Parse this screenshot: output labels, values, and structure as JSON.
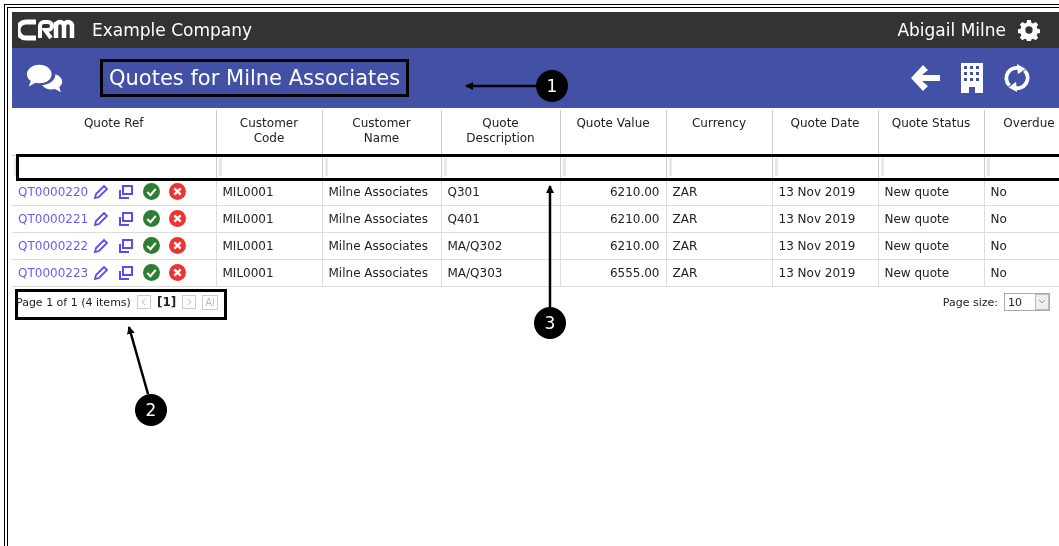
{
  "topbar": {
    "company": "Example Company",
    "user": "Abigail Milne"
  },
  "header": {
    "title": "Quotes for Milne Associates"
  },
  "table": {
    "columns": [
      "Quote Ref",
      "Customer Code",
      "Customer Name",
      "Quote Description",
      "Quote Value",
      "Currency",
      "Quote Date",
      "Quote Status",
      "Overdue"
    ],
    "rows": [
      {
        "ref": "QT0000220",
        "code": "MIL0001",
        "name": "Milne Associates",
        "description": "Q301",
        "value": "6210.00",
        "currency": "ZAR",
        "date": "13 Nov 2019",
        "status": "New quote",
        "overdue": "No"
      },
      {
        "ref": "QT0000221",
        "code": "MIL0001",
        "name": "Milne Associates",
        "description": "Q401",
        "value": "6210.00",
        "currency": "ZAR",
        "date": "13 Nov 2019",
        "status": "New quote",
        "overdue": "No"
      },
      {
        "ref": "QT0000222",
        "code": "MIL0001",
        "name": "Milne Associates",
        "description": "MA/Q302",
        "value": "6210.00",
        "currency": "ZAR",
        "date": "13 Nov 2019",
        "status": "New quote",
        "overdue": "No"
      },
      {
        "ref": "QT0000223",
        "code": "MIL0001",
        "name": "Milne Associates",
        "description": "MA/Q303",
        "value": "6555.00",
        "currency": "ZAR",
        "date": "13 Nov 2019",
        "status": "New quote",
        "overdue": "No"
      }
    ]
  },
  "pager": {
    "summary": "Page 1 of 1 (4 items)",
    "current_page": "[1]",
    "all_button": "Al",
    "page_size_label": "Page size:",
    "page_size": "10"
  },
  "callouts": [
    {
      "number": "1"
    },
    {
      "number": "2"
    },
    {
      "number": "3"
    }
  ]
}
